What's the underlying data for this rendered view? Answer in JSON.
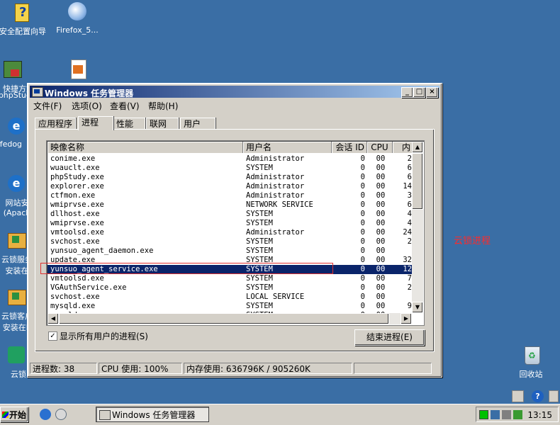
{
  "desktop": {
    "icons": [
      {
        "label": "安全配置向导",
        "icon": "security-wizard-icon"
      },
      {
        "label": "Firefox_5...",
        "icon": "firefox-setup-icon"
      },
      {
        "label": "快捷方式",
        "icon": "shortcut-icon"
      },
      {
        "label": "phpStud",
        "icon": "phpstudy-icon"
      },
      {
        "label": "afedog",
        "icon": "safedog-icon"
      },
      {
        "label": "网站安",
        "icon": "site-security-icon"
      },
      {
        "label": "(Apach",
        "icon": "apache-icon"
      },
      {
        "label": "云锁服务",
        "icon": "yunsuo-service-icon"
      },
      {
        "label": "安装在",
        "icon": "yunsuo-install-icon"
      },
      {
        "label": "云锁客户",
        "icon": "yunsuo-client-icon"
      },
      {
        "label": "安装在B",
        "icon": "yunsuo-client-install-icon"
      },
      {
        "label": "云锁",
        "icon": "yunsuo-icon"
      },
      {
        "label": "回收站",
        "icon": "recycle-bin-icon"
      }
    ],
    "annotation": "云锁进程"
  },
  "window": {
    "title": "Windows 任务管理器",
    "controls": {
      "minimize": "_",
      "maximize": "□",
      "close": "×"
    },
    "menu": [
      "文件(F)",
      "选项(O)",
      "查看(V)",
      "帮助(H)"
    ],
    "tabs": [
      "应用程序",
      "进程",
      "性能",
      "联网",
      "用户"
    ],
    "active_tab": "进程",
    "columns": [
      "映像名称",
      "用户名",
      "会话 ID",
      "CPU",
      "内"
    ],
    "processes": [
      {
        "name": "conime.exe",
        "user": "Administrator",
        "session": "0",
        "cpu": "00",
        "mem": "2"
      },
      {
        "name": "wuauclt.exe",
        "user": "SYSTEM",
        "session": "0",
        "cpu": "00",
        "mem": "6"
      },
      {
        "name": "phpStudy.exe",
        "user": "Administrator",
        "session": "0",
        "cpu": "00",
        "mem": "6"
      },
      {
        "name": "explorer.exe",
        "user": "Administrator",
        "session": "0",
        "cpu": "00",
        "mem": "14"
      },
      {
        "name": "ctfmon.exe",
        "user": "Administrator",
        "session": "0",
        "cpu": "00",
        "mem": "3"
      },
      {
        "name": "wmiprvse.exe",
        "user": "NETWORK SERVICE",
        "session": "0",
        "cpu": "00",
        "mem": "6"
      },
      {
        "name": "dllhost.exe",
        "user": "SYSTEM",
        "session": "0",
        "cpu": "00",
        "mem": "4"
      },
      {
        "name": "wmiprvse.exe",
        "user": "SYSTEM",
        "session": "0",
        "cpu": "00",
        "mem": "4"
      },
      {
        "name": "vmtoolsd.exe",
        "user": "Administrator",
        "session": "0",
        "cpu": "00",
        "mem": "24"
      },
      {
        "name": "svchost.exe",
        "user": "SYSTEM",
        "session": "0",
        "cpu": "00",
        "mem": "2"
      },
      {
        "name": "yunsuo_agent_daemon.exe",
        "user": "SYSTEM",
        "session": "0",
        "cpu": "00",
        "mem": ""
      },
      {
        "name": "update.exe",
        "user": "SYSTEM",
        "session": "0",
        "cpu": "00",
        "mem": "32"
      },
      {
        "name": "yunsuo_agent_service.exe",
        "user": "SYSTEM",
        "session": "0",
        "cpu": "00",
        "mem": "12"
      },
      {
        "name": "vmtoolsd.exe",
        "user": "SYSTEM",
        "session": "0",
        "cpu": "00",
        "mem": "7"
      },
      {
        "name": "VGAuthService.exe",
        "user": "SYSTEM",
        "session": "0",
        "cpu": "00",
        "mem": "2"
      },
      {
        "name": "svchost.exe",
        "user": "LOCAL SERVICE",
        "session": "0",
        "cpu": "00",
        "mem": ""
      },
      {
        "name": "mysqld.exe",
        "user": "SYSTEM",
        "session": "0",
        "cpu": "00",
        "mem": "9"
      },
      {
        "name": "mysqld.exe",
        "user": "SYSTEM",
        "session": "0",
        "cpu": "00",
        "mem": ""
      }
    ],
    "selected_index": 12,
    "show_all_users": {
      "label": "显示所有用户的进程(S)",
      "checked": true
    },
    "end_process_label": "结束进程(E)",
    "status": {
      "processes": "进程数: 38",
      "cpu": "CPU 使用: 100%",
      "memory": "内存使用: 636796K / 905260K"
    }
  },
  "taskbar": {
    "start_label": "开始",
    "active_app": "Windows 任务管理器",
    "clock": "13:15"
  }
}
